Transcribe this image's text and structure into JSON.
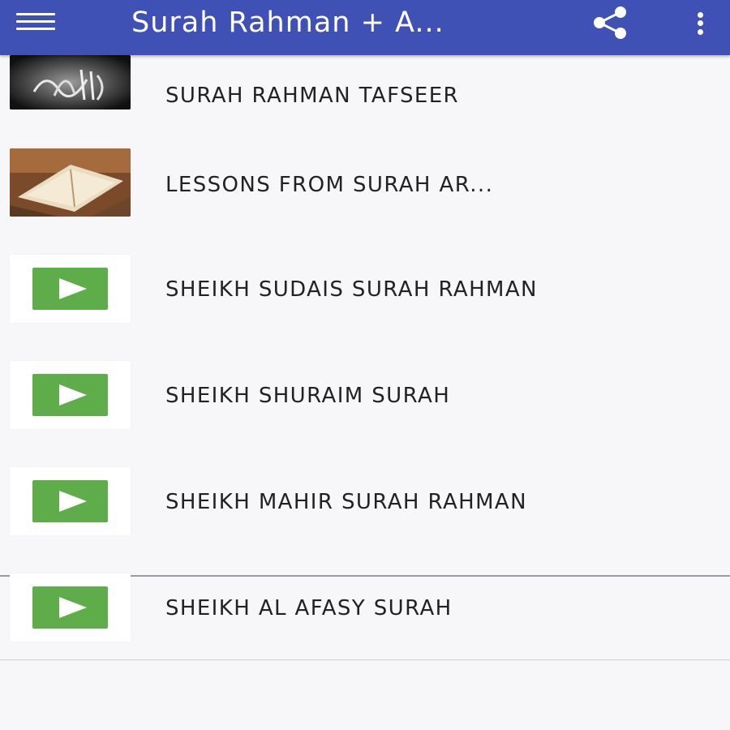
{
  "app_bar": {
    "title": "Surah Rahman + A...",
    "menu_icon": "hamburger-menu-icon",
    "share_icon": "share-icon",
    "more_icon": "more-vert-icon",
    "color": "#3f51b5"
  },
  "list": {
    "items": [
      {
        "label": "SURAH RAHMAN TAFSEER",
        "thumbnail": "calligraphy-image"
      },
      {
        "label": "LESSONS FROM SURAH AR...",
        "thumbnail": "quran-book-image"
      },
      {
        "label": "SHEIKH SUDAIS SURAH RAHMAN",
        "thumbnail": "play-icon"
      },
      {
        "label": "SHEIKH SHURAIM SURAH",
        "thumbnail": "play-icon"
      },
      {
        "label": "SHEIKH MAHIR SURAH RAHMAN",
        "thumbnail": "play-icon"
      },
      {
        "label": "SHEIKH AL AFASY SURAH",
        "thumbnail": "play-icon"
      }
    ],
    "play_color": "#5fac4a"
  }
}
